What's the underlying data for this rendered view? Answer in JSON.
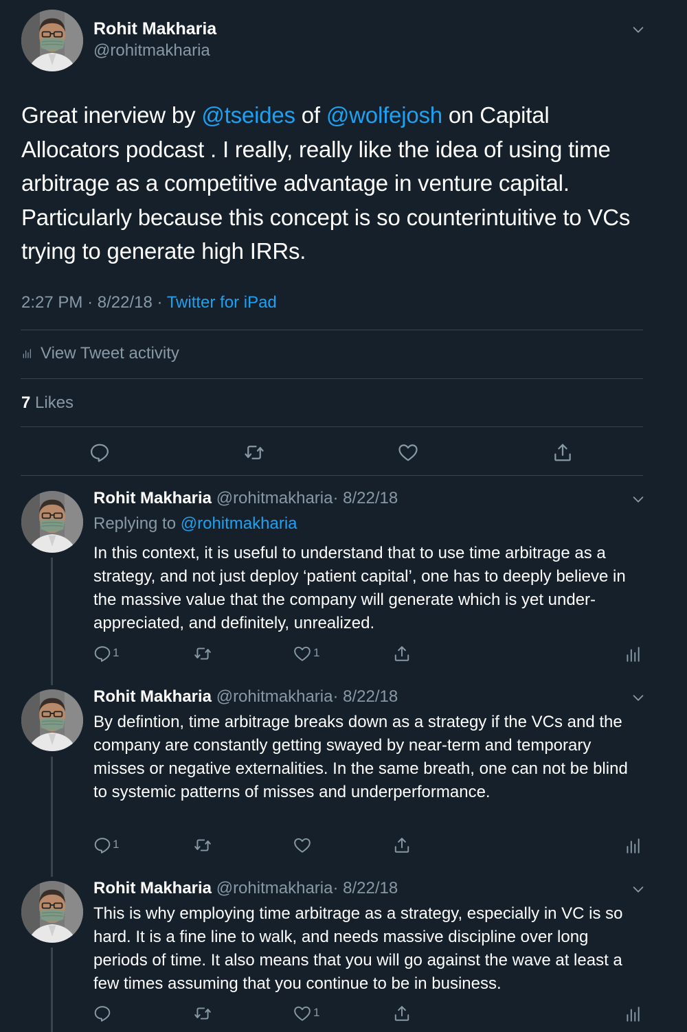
{
  "main_tweet": {
    "author_name": "Rohit Makharia",
    "author_handle": "@rohitmakharia",
    "text_parts": [
      "Great inerview by ",
      "@tseides",
      " of ",
      "@wolfejosh",
      " on Capital Allocators podcast . I really, really like the idea of using time arbitrage as a competitive advantage in venture capital. Particularly because this concept is so counterintuitive to VCs trying to generate high IRRs."
    ],
    "time": "2:27 PM",
    "separator": "·",
    "date": "8/22/18",
    "source": "Twitter for iPad",
    "activity_label": "View Tweet activity",
    "likes_count": "7",
    "likes_label": "Likes"
  },
  "replies": [
    {
      "author_name": "Rohit Makharia",
      "author_handle": "@rohitmakharia",
      "date_text": "· 8/22/18",
      "replying_prefix": "Replying to",
      "replying_handle": "@rohitmakharia",
      "text": "In this context, it is useful to understand that to use time arbitrage as a strategy, and not just deploy ‘patient capital’, one has to deeply believe in the massive value that the company will generate which is yet under-appreciated, and definitely, unrealized.",
      "reply_count": "1",
      "retweet_count": "",
      "like_count": "1"
    },
    {
      "author_name": "Rohit Makharia",
      "author_handle": "@rohitmakharia",
      "date_text": "· 8/22/18",
      "text": "By defintion, time arbitrage breaks down as a strategy if the VCs and the company are constantly getting swayed by near-term and temporary misses or negative externalities. In the same breath, one can not be blind to systemic patterns of misses and underperformance.",
      "reply_count": "1",
      "retweet_count": "",
      "like_count": ""
    },
    {
      "author_name": "Rohit Makharia",
      "author_handle": "@rohitmakharia",
      "date_text": "· 8/22/18",
      "text": "This is why employing time arbitrage as a strategy, especially in VC is so hard. It is a fine line to walk, and needs massive discipline over long periods of time. It also means that you will go against the wave at least a few times assuming that you continue to be in business.",
      "reply_count": "",
      "retweet_count": "",
      "like_count": "1"
    }
  ],
  "colors": {
    "background": "#15202b",
    "text": "#ffffff",
    "muted": "#8899a6",
    "link": "#1da1f2",
    "divider": "#38444d"
  },
  "icons": [
    "avatar",
    "chevron-down-icon",
    "reply-icon",
    "retweet-icon",
    "like-icon",
    "share-icon",
    "analytics-icon"
  ]
}
